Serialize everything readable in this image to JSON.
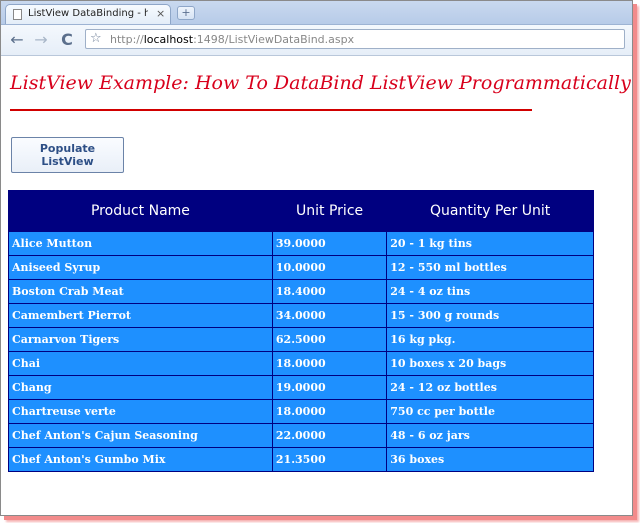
{
  "browser": {
    "tab_title": "ListView DataBinding - how ...",
    "tab_close_glyph": "×",
    "new_tab_glyph": "+",
    "url_prefix": "http://",
    "url_host": "localhost",
    "url_rest": ":1498/ListViewDataBind.aspx",
    "back_glyph": "←",
    "forward_glyph": "→",
    "reload_glyph": "C",
    "star_glyph": "☆"
  },
  "page": {
    "heading": "ListView Example: How To DataBind ListView Programmatically",
    "button_label": "Populate ListView",
    "accent_color": "#d8001c"
  },
  "table": {
    "headers": [
      "Product Name",
      "Unit Price",
      "Quantity Per Unit"
    ],
    "rows": [
      [
        "Alice Mutton",
        "39.0000",
        "20 - 1 kg tins"
      ],
      [
        "Aniseed Syrup",
        "10.0000",
        "12 - 550 ml bottles"
      ],
      [
        "Boston Crab Meat",
        "18.4000",
        "24 - 4 oz tins"
      ],
      [
        "Camembert Pierrot",
        "34.0000",
        "15 - 300 g rounds"
      ],
      [
        "Carnarvon Tigers",
        "62.5000",
        "16 kg pkg."
      ],
      [
        "Chai",
        "18.0000",
        "10 boxes x 20 bags"
      ],
      [
        "Chang",
        "19.0000",
        "24 - 12 oz bottles"
      ],
      [
        "Chartreuse verte",
        "18.0000",
        "750 cc per bottle"
      ],
      [
        "Chef Anton's Cajun Seasoning",
        "22.0000",
        "48 - 6 oz jars"
      ],
      [
        "Chef Anton's Gumbo Mix",
        "21.3500",
        "36 boxes"
      ]
    ],
    "header_bg": "#000080",
    "row_bg": "#1e90ff"
  }
}
